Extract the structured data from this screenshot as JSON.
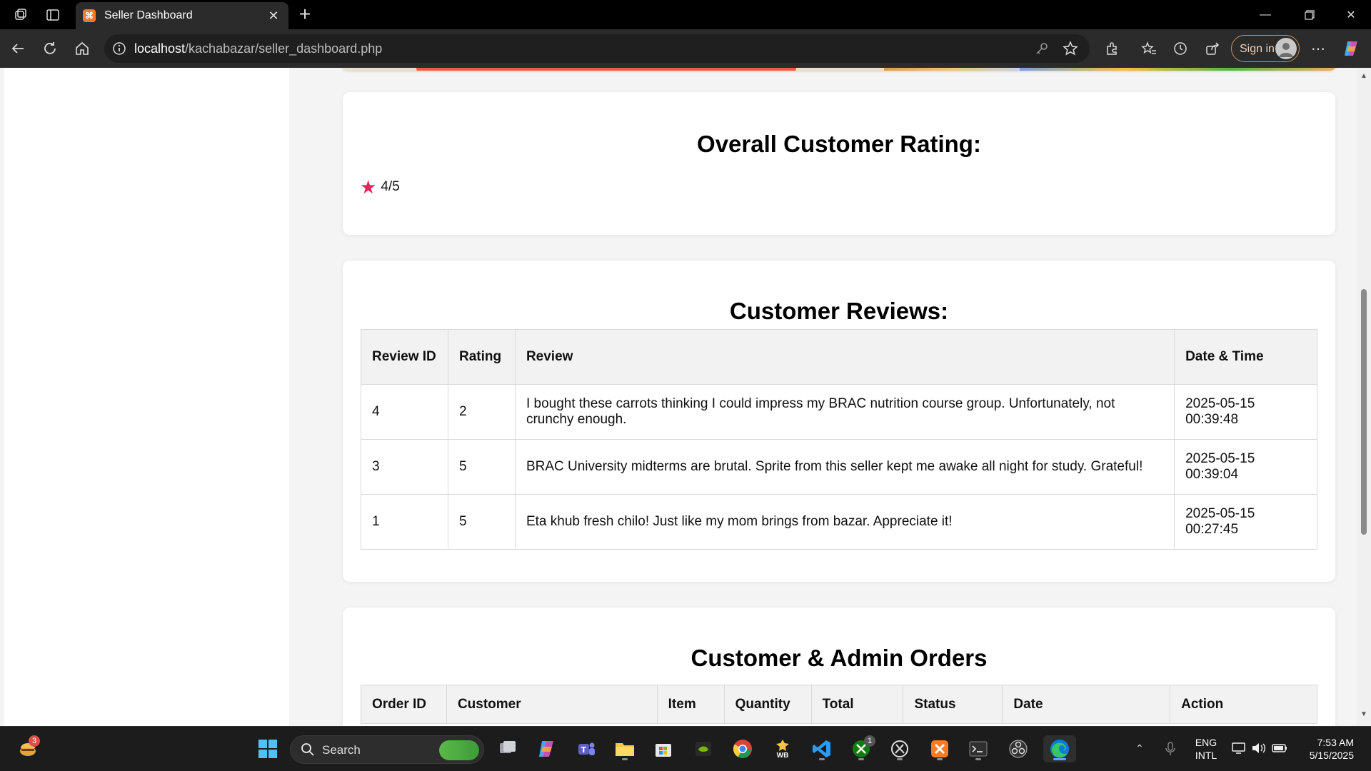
{
  "browser": {
    "tab_title": "Seller Dashboard",
    "url_host": "localhost",
    "url_path": "/kachabazar/seller_dashboard.php",
    "sign_in_label": "Sign in"
  },
  "overall_rating": {
    "heading": "Overall Customer Rating:",
    "value": "4/5"
  },
  "reviews": {
    "heading": "Customer Reviews:",
    "columns": [
      "Review ID",
      "Rating",
      "Review",
      "Date & Time"
    ],
    "rows": [
      {
        "id": "4",
        "rating": "2",
        "review": "I bought these carrots thinking I could impress my BRAC nutrition course group. Unfortunately, not crunchy enough.",
        "date": "2025-05-15",
        "time": "00:39:48"
      },
      {
        "id": "3",
        "rating": "5",
        "review": "BRAC University midterms are brutal. Sprite from this seller kept me awake all night for study. Grateful!",
        "date": "2025-05-15",
        "time": "00:39:04"
      },
      {
        "id": "1",
        "rating": "5",
        "review": "Eta khub fresh chilo! Just like my mom brings from bazar. Appreciate it!",
        "date": "2025-05-15",
        "time": "00:27:45"
      }
    ]
  },
  "orders": {
    "heading": "Customer & Admin Orders",
    "columns": [
      "Order ID",
      "Customer",
      "Item",
      "Quantity",
      "Total",
      "Status",
      "Date",
      "Action"
    ]
  },
  "taskbar": {
    "search_label": "Search",
    "widget_badge": "3",
    "xbox_badge": "1",
    "lang_line1": "ENG",
    "lang_line2": "INTL",
    "time": "7:53 AM",
    "date": "5/15/2025",
    "wb_label": "WB"
  },
  "colors": {
    "accent_star": "#e8245a",
    "xampp_orange": "#fb7a24",
    "edge_blue": "#58a6ff"
  }
}
